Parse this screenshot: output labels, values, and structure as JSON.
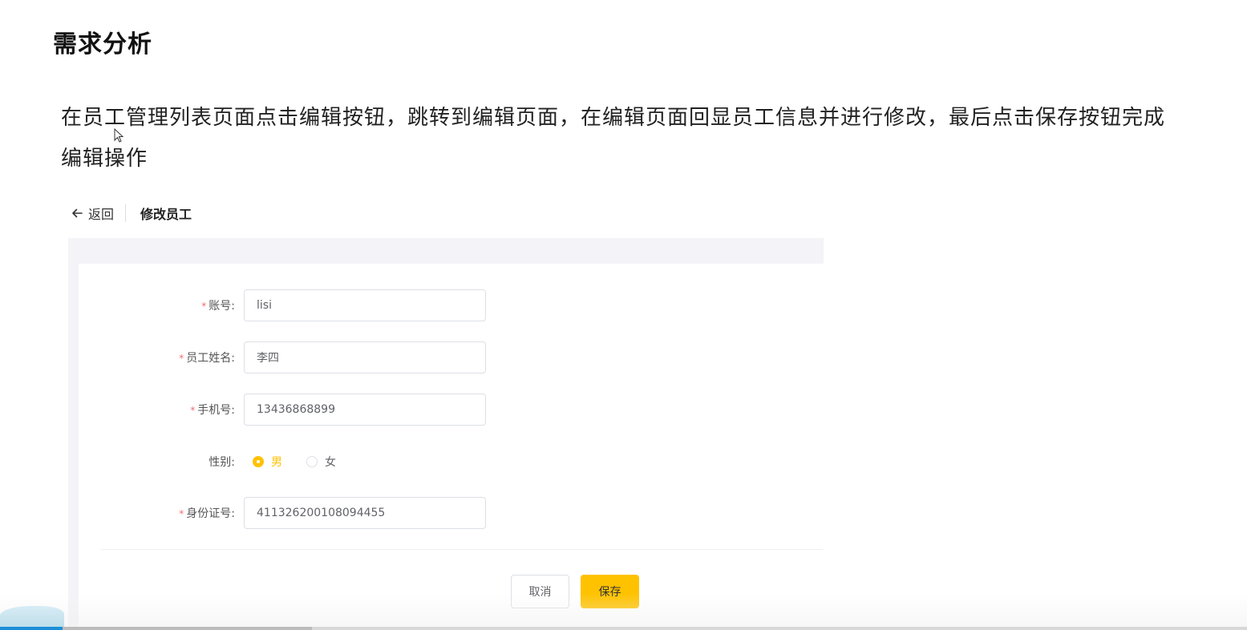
{
  "slide": {
    "title": "需求分析",
    "description": "在员工管理列表页面点击编辑按钮，跳转到编辑页面，在编辑页面回显员工信息并进行修改，最后点击保存按钮完成编辑操作"
  },
  "app": {
    "back_label": "返回",
    "page_title": "修改员工",
    "form": {
      "account": {
        "label": "账号:",
        "value": "lisi"
      },
      "name": {
        "label": "员工姓名:",
        "value": "李四"
      },
      "phone": {
        "label": "手机号:",
        "value": "13436868899"
      },
      "gender": {
        "label": "性别:",
        "options": [
          "男",
          "女"
        ],
        "selected": "男"
      },
      "id_number": {
        "label": "身份证号:",
        "value": "411326200108094455"
      }
    },
    "buttons": {
      "cancel": "取消",
      "save": "保存"
    }
  },
  "colors": {
    "accent": "#ffc200",
    "required": "#f56c6c",
    "progress": "#1a8fd8"
  },
  "video_progress": {
    "played_fraction": 0.05,
    "buffered_fraction": 0.25
  }
}
